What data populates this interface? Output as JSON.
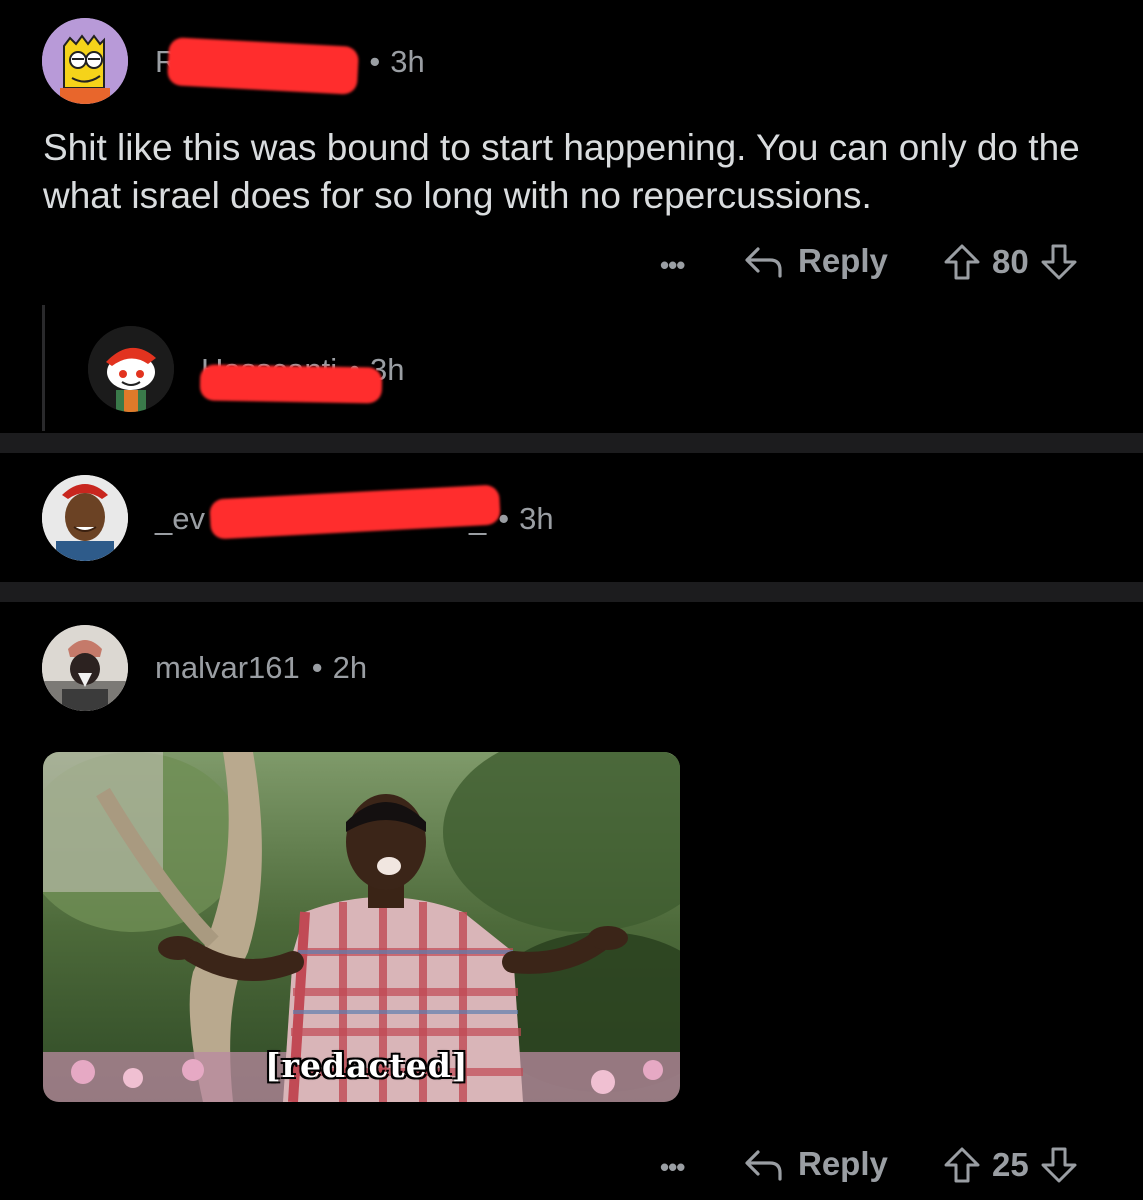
{
  "comments": [
    {
      "username": "R",
      "time": "3h",
      "text": "Shit like this was bound to start happening. You can only do the what israel does for so long with no repercussions.",
      "more": "•••",
      "reply_label": "Reply",
      "votes": "80"
    },
    {
      "username": "Hasscanti",
      "time": "3h"
    },
    {
      "username": "_ev",
      "username_tail": "_",
      "time": "3h"
    },
    {
      "username": "malvar161",
      "time": "2h",
      "media_caption": "[redacted]",
      "more": "•••",
      "reply_label": "Reply",
      "votes": "25"
    }
  ],
  "separator": "•",
  "colors": {
    "background": "#000000",
    "text": "#d9dcde",
    "meta": "#9a9ea3",
    "divider": "#1c1c1e",
    "redaction": "#ff2d2d"
  }
}
